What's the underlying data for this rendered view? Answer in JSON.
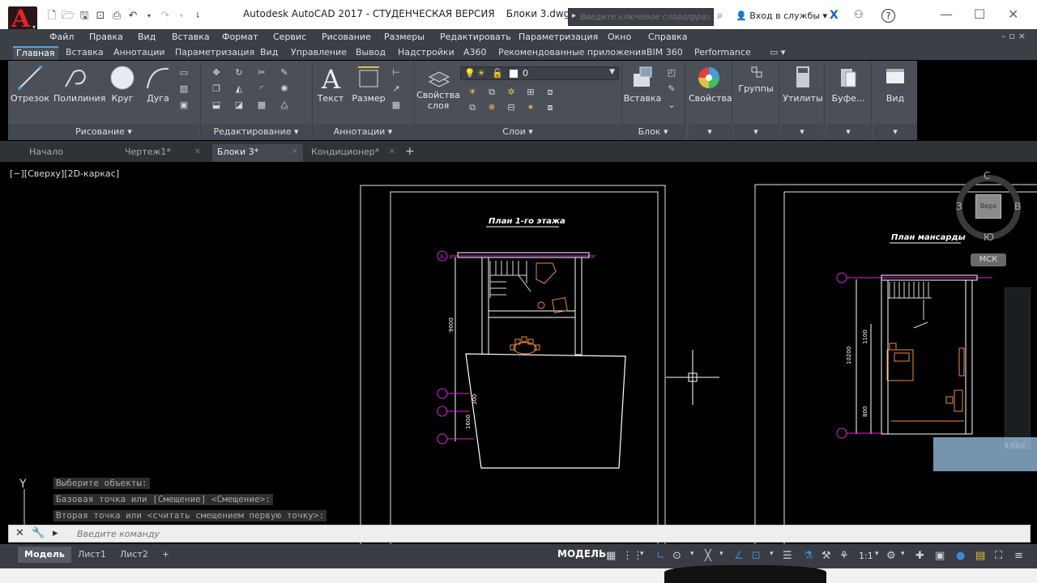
{
  "app": {
    "title": "Autodesk AutoCAD 2017 - СТУДЕНЧЕСКАЯ ВЕРСИЯ",
    "filename": "Блоки 3.dwg",
    "logo_letter": "A",
    "search_placeholder": "Введите ключевое слово/фразу",
    "signin_label": "Вход в службы",
    "help_label": "?"
  },
  "menu": [
    "Файл",
    "Правка",
    "Вид",
    "Вставка",
    "Формат",
    "Сервис",
    "Рисование",
    "Размеры",
    "Редактировать",
    "Параметризация",
    "Окно",
    "Справка"
  ],
  "ribbon_tabs": [
    "Главная",
    "Вставка",
    "Аннотации",
    "Параметризация",
    "Вид",
    "Управление",
    "Вывод",
    "Надстройки",
    "A360",
    "Рекомендованные приложения",
    "BIM 360",
    "Performance"
  ],
  "active_ribbon_tab": "Главная",
  "ribbon": {
    "draw_tools": [
      "Отрезок",
      "Полилиния",
      "Круг",
      "Дуга"
    ],
    "annotation_tools": [
      "Текст",
      "Размер"
    ],
    "layer_tool": [
      "Свойства",
      "слоя"
    ],
    "block_tool": "Вставка",
    "big_tools": [
      "Свойства",
      "Группы",
      "Утилиты",
      "Буфе...",
      "Вид"
    ],
    "panels": [
      "Рисование ▾",
      "Редактирование ▾",
      "Аннотации ▾",
      "Слои ▾",
      "Блок ▾"
    ],
    "current_layer": "0"
  },
  "file_tabs": [
    {
      "label": "Начало",
      "closable": false
    },
    {
      "label": "Чертеж1*",
      "closable": true
    },
    {
      "label": "Блоки 3*",
      "closable": true
    },
    {
      "label": "Кондиционер*",
      "closable": true
    }
  ],
  "active_file_tab": "Блоки 3*",
  "viewport": {
    "label": "[−][Сверху][2D-каркас]",
    "viewcube": {
      "north": "С",
      "south": "Ю",
      "west": "З",
      "east": "В",
      "face": "Верх"
    },
    "wcs": "МСК",
    "overlay_text": "5 КБ/с"
  },
  "drawing": {
    "plan_left_title": "План 1-го этажа",
    "plan_right_title": "План мансарды",
    "axis_marker": "A",
    "dims_left": [
      "9000",
      "300",
      "1600"
    ],
    "dims_right": [
      "10200",
      "1100",
      "800"
    ]
  },
  "ucs_label": "Y",
  "command": {
    "history": [
      "Выберите объекты:",
      "Базовая точка или [Смещение] <Смещение>:",
      "Вторая точка или <считать смещением первую точку>:"
    ],
    "placeholder": "Введите команду"
  },
  "layout_tabs": [
    "Модель",
    "Лист1",
    "Лист2"
  ],
  "active_layout_tab": "Модель",
  "status": {
    "model_label": "МОДЕЛЬ",
    "annotation_scale": "1:1"
  },
  "colors": {
    "accent": "#5aa4e0",
    "magenta": "#e020e0",
    "orange": "#f08a3a",
    "background": "#000000"
  }
}
